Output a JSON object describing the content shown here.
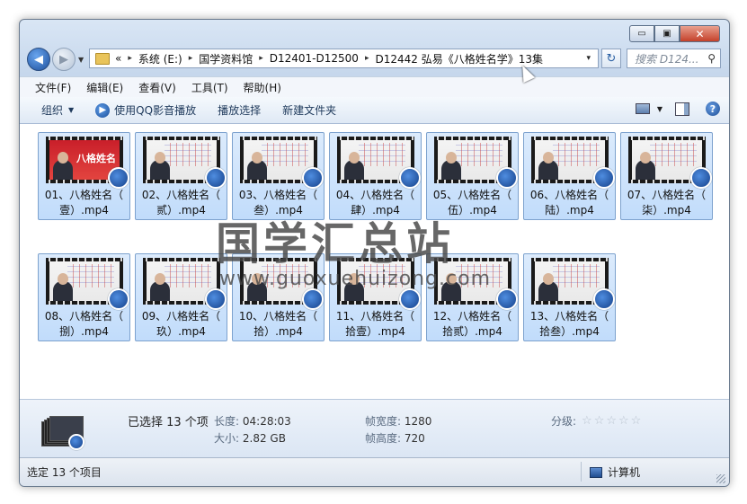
{
  "window": {
    "caption_buttons": {
      "minimize": "▭",
      "maximize": "▣",
      "close": "✕"
    }
  },
  "address": {
    "prefix": "«",
    "crumbs": [
      "系统 (E:)",
      "国学资料馆",
      "D12401-D12500",
      "D12442 弘易《八格姓名学》13集"
    ],
    "separator": "▸",
    "dropdown": "▾"
  },
  "search": {
    "placeholder": "搜索 D124...",
    "icon": "magnifier-icon"
  },
  "menu": [
    "文件(F)",
    "编辑(E)",
    "查看(V)",
    "工具(T)",
    "帮助(H)"
  ],
  "toolbar": {
    "organize": "组织",
    "qq_play": "使用QQ影音播放",
    "play_selection": "播放选择",
    "new_folder": "新建文件夹",
    "help": "?"
  },
  "files": [
    {
      "line1": "01、八格姓名（",
      "line2": "壹）.mp4",
      "thumb_text": "八格姓名"
    },
    {
      "line1": "02、八格姓名（",
      "line2": "贰）.mp4"
    },
    {
      "line1": "03、八格姓名（",
      "line2": "叁）.mp4"
    },
    {
      "line1": "04、八格姓名（",
      "line2": "肆）.mp4"
    },
    {
      "line1": "05、八格姓名（",
      "line2": "伍）.mp4"
    },
    {
      "line1": "06、八格姓名（",
      "line2": "陆）.mp4"
    },
    {
      "line1": "07、八格姓名（",
      "line2": "柒）.mp4"
    },
    {
      "line1": "08、八格姓名（",
      "line2": "捌）.mp4"
    },
    {
      "line1": "09、八格姓名（",
      "line2": "玖）.mp4"
    },
    {
      "line1": "10、八格姓名（",
      "line2": "拾）.mp4"
    },
    {
      "line1": "11、八格姓名（",
      "line2": "拾壹）.mp4"
    },
    {
      "line1": "12、八格姓名（",
      "line2": "拾贰）.mp4"
    },
    {
      "line1": "13、八格姓名（",
      "line2": "拾叁）.mp4"
    }
  ],
  "watermark": {
    "title": "国学汇总站",
    "url": "www.guoxuehuizong.com"
  },
  "details": {
    "selected": "已选择 13 个项",
    "length_label": "长度:",
    "length_value": "04:28:03",
    "size_label": "大小:",
    "size_value": "2.82 GB",
    "frame_width_label": "帧宽度:",
    "frame_width_value": "1280",
    "frame_height_label": "帧高度:",
    "frame_height_value": "720",
    "rating_label": "分级:",
    "rating": 0,
    "stars": [
      "☆",
      "☆",
      "☆",
      "☆",
      "☆"
    ]
  },
  "status": {
    "left": "选定 13 个项目",
    "right": "计算机"
  },
  "colors": {
    "tile_bg": "#c8e0fb",
    "tile_border": "#7da2ce",
    "accent": "#1d4f9c"
  }
}
